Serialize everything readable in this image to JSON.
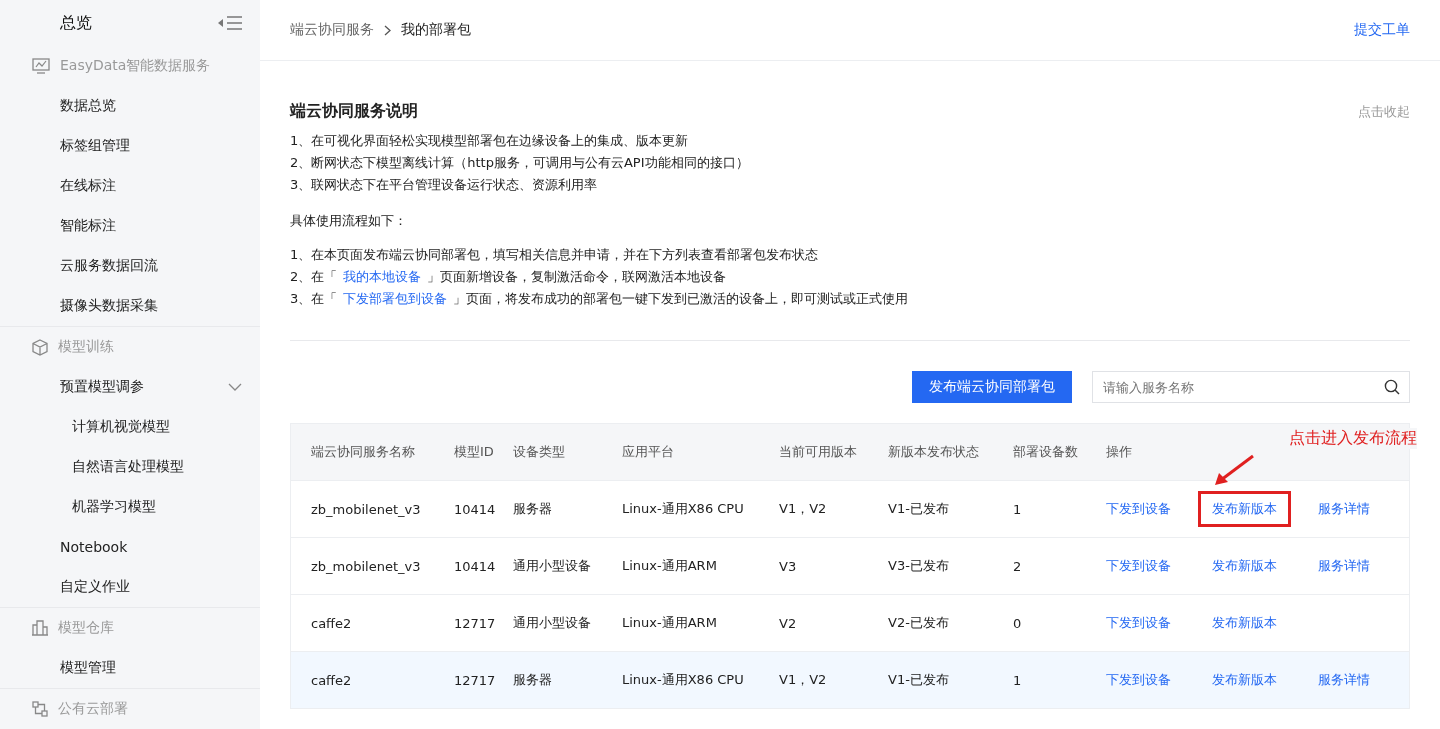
{
  "sidebar": {
    "title": "总览",
    "groups": [
      {
        "title": "EasyData智能数据服务",
        "items": [
          {
            "label": "数据总览"
          },
          {
            "label": "标签组管理"
          },
          {
            "label": "在线标注"
          },
          {
            "label": "智能标注"
          },
          {
            "label": "云服务数据回流"
          },
          {
            "label": "摄像头数据采集"
          }
        ]
      },
      {
        "title": "模型训练",
        "items": [
          {
            "label": "预置模型调参",
            "expanded": true,
            "children": [
              {
                "label": "计算机视觉模型"
              },
              {
                "label": "自然语言处理模型"
              },
              {
                "label": "机器学习模型"
              }
            ]
          },
          {
            "label": "Notebook"
          },
          {
            "label": "自定义作业"
          }
        ]
      },
      {
        "title": "模型仓库",
        "items": [
          {
            "label": "模型管理"
          }
        ]
      },
      {
        "title": "公有云部署"
      }
    ]
  },
  "breadcrumb": [
    "端云协同服务",
    "我的部署包"
  ],
  "header_link": "提交工单",
  "intro": {
    "title": "端云协同服务说明",
    "collapse": "点击收起",
    "features": [
      "1、在可视化界面轻松实现模型部署包在边缘设备上的集成、版本更新",
      "2、断网状态下模型离线计算（http服务，可调用与公有云API功能相同的接口）",
      "3、联网状态下在平台管理设备运行状态、资源利用率"
    ],
    "steps_title": "具体使用流程如下：",
    "steps": [
      {
        "parts": [
          {
            "kind": "text",
            "text": "1、在本页面发布端云协同部署包，填写相关信息并申请，并在下方列表查看部署包发布状态"
          }
        ]
      },
      {
        "parts": [
          {
            "kind": "text",
            "text": "2、在「"
          },
          {
            "kind": "link",
            "text": "我的本地设备"
          },
          {
            "kind": "text",
            "text": "」页面新增设备，复制激活命令，联网激活本地设备"
          }
        ]
      },
      {
        "parts": [
          {
            "kind": "text",
            "text": "3、在「"
          },
          {
            "kind": "link",
            "text": "下发部署包到设备"
          },
          {
            "kind": "text",
            "text": "」页面，将发布成功的部署包一键下发到已激活的设备上，即可测试或正式使用"
          }
        ]
      }
    ]
  },
  "toolbar": {
    "button": "发布端云协同部署包",
    "search_placeholder": "请输入服务名称"
  },
  "table": {
    "columns": [
      "端云协同服务名称",
      "模型ID",
      "设备类型",
      "应用平台",
      "当前可用版本",
      "新版本发布状态",
      "部署设备数",
      "操作"
    ],
    "rows": [
      {
        "highlighted": false,
        "cells": [
          "zb_mobilenet_v3",
          "10414",
          "服务器",
          "Linux-通用X86 CPU",
          "V1，V2",
          "V1-已发布",
          "1"
        ],
        "actions": [
          {
            "text": "下发到设备",
            "boxed": false
          },
          {
            "text": "发布新版本",
            "boxed": true
          },
          {
            "text": "服务详情",
            "boxed": false
          }
        ]
      },
      {
        "highlighted": false,
        "cells": [
          "zb_mobilenet_v3",
          "10414",
          "通用小型设备",
          "Linux-通用ARM",
          "V3",
          "V3-已发布",
          "2"
        ],
        "actions": [
          {
            "text": "下发到设备",
            "boxed": false
          },
          {
            "text": "发布新版本",
            "boxed": false
          },
          {
            "text": "服务详情",
            "boxed": false
          }
        ]
      },
      {
        "highlighted": false,
        "cells": [
          "caffe2",
          "12717",
          "通用小型设备",
          "Linux-通用ARM",
          "V2",
          "V2-已发布",
          "0"
        ],
        "actions": [
          {
            "text": "下发到设备",
            "boxed": false
          },
          {
            "text": "发布新版本",
            "boxed": false
          }
        ]
      },
      {
        "highlighted": true,
        "cells": [
          "caffe2",
          "12717",
          "服务器",
          "Linux-通用X86 CPU",
          "V1，V2",
          "V1-已发布",
          "1"
        ],
        "actions": [
          {
            "text": "下发到设备",
            "boxed": false
          },
          {
            "text": "发布新版本",
            "boxed": false
          },
          {
            "text": "服务详情",
            "boxed": false
          }
        ]
      }
    ],
    "callout": "点击进入发布流程"
  }
}
